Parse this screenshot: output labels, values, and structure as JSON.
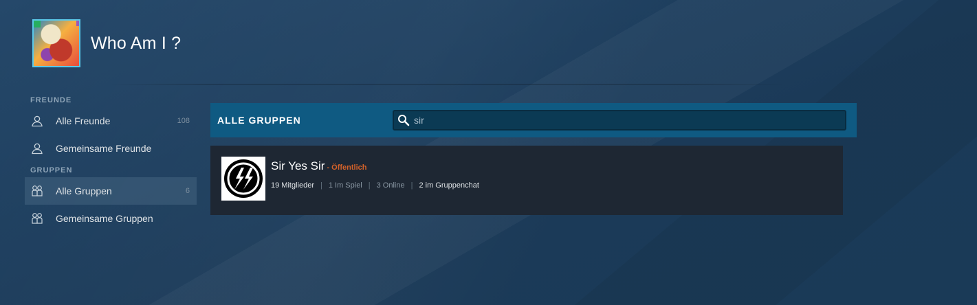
{
  "profile": {
    "name": "Who Am I ?"
  },
  "sidebar": {
    "friends_section": "FREUNDE",
    "friends_items": [
      {
        "label": "Alle Freunde",
        "count": "108",
        "icon": "person-icon"
      },
      {
        "label": "Gemeinsame Freunde",
        "count": "",
        "icon": "person-icon"
      }
    ],
    "groups_section": "GRUPPEN",
    "groups_items": [
      {
        "label": "Alle Gruppen",
        "count": "6",
        "icon": "group-icon",
        "active": true
      },
      {
        "label": "Gemeinsame Gruppen",
        "count": "",
        "icon": "group-icon"
      }
    ]
  },
  "main": {
    "title": "ALLE GRUPPEN",
    "search": {
      "value": "sir",
      "placeholder": ""
    },
    "groups": [
      {
        "name": "Sir Yes Sir",
        "visibility": "- Öffentlich",
        "members": "19 Mitglieder",
        "in_game": "1 Im Spiel",
        "online": "3 Online",
        "in_chat": "2 im Gruppenchat"
      }
    ]
  },
  "colors": {
    "accent_header": "#0f5a82",
    "public_label": "#d4622a",
    "row_background": "#1e2733"
  }
}
